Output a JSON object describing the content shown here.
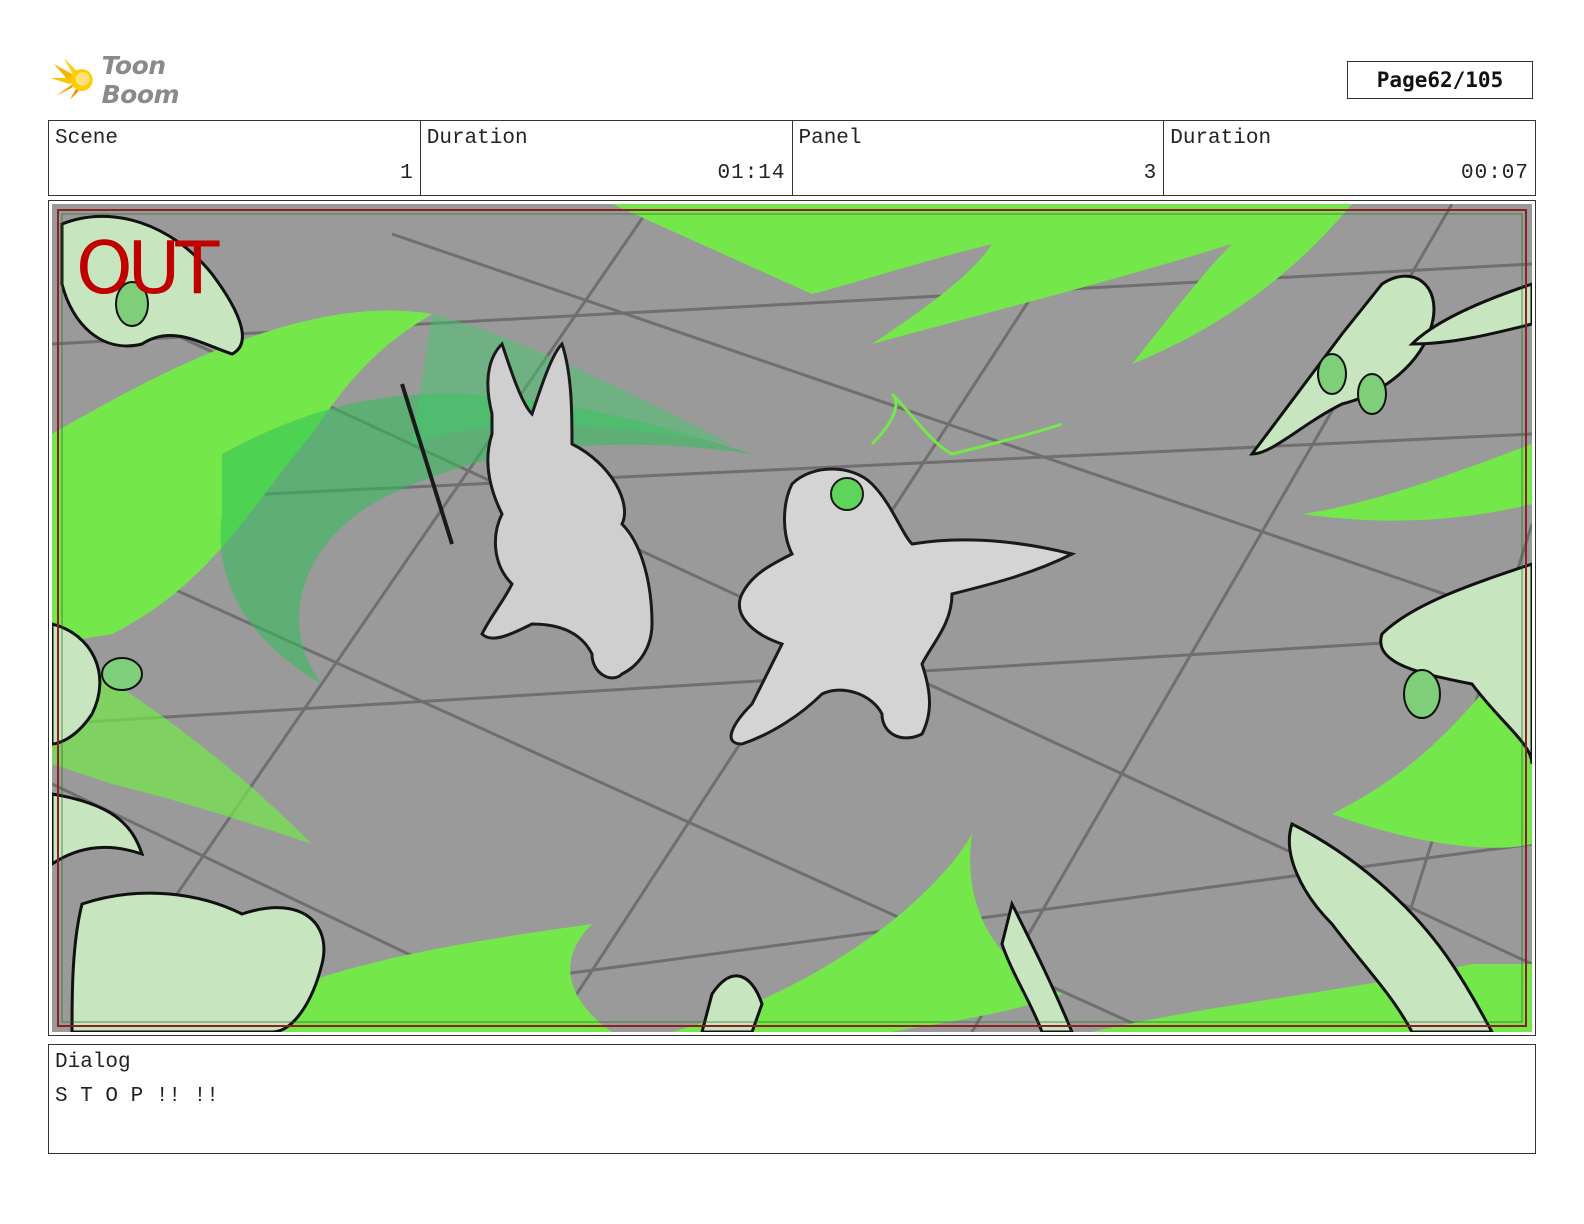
{
  "header": {
    "logo_text": "Toon Boom",
    "page_label": "Page",
    "page_number": "62/105"
  },
  "info": {
    "scene_label": "Scene",
    "scene_value": "1",
    "scene_duration_label": "Duration",
    "scene_duration_value": "01:14",
    "panel_label": "Panel",
    "panel_value": "3",
    "panel_duration_label": "Duration",
    "panel_duration_value": "00:07"
  },
  "panel": {
    "overlay_text": "OUT",
    "overlay_color": "#c00000",
    "frame_color": "#8a2020"
  },
  "dialog": {
    "label": "Dialog",
    "text": "S T O P !! !!"
  },
  "colors": {
    "floor": "#9a9a9a",
    "energy_green": "#74e84a",
    "ghost_green": "#b9e3b3",
    "sketch": "#222222"
  }
}
